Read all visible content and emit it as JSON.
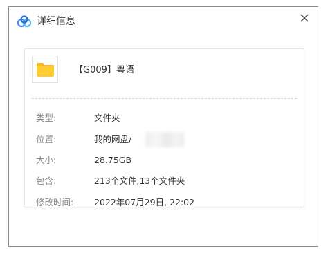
{
  "titlebar": {
    "title": "详细信息",
    "close_label": "×"
  },
  "item": {
    "name": "【G009】粤语"
  },
  "details": [
    {
      "label": "类型:",
      "value": "文件夹"
    },
    {
      "label": "位置:",
      "value": "我的网盘/"
    },
    {
      "label": "大小:",
      "value": "28.75GB"
    },
    {
      "label": "包含:",
      "value": "213个文件,13个文件夹"
    },
    {
      "label": "修改时间:",
      "value": "2022年07月29日, 22:02"
    }
  ],
  "colors": {
    "folder": "#ffcc33",
    "folder_dark": "#f5b820",
    "brand_blue": "#3b8cf5"
  },
  "icons": {
    "app": "baidu-netdisk-cloud-icon",
    "close": "close-icon",
    "folder": "folder-icon"
  }
}
